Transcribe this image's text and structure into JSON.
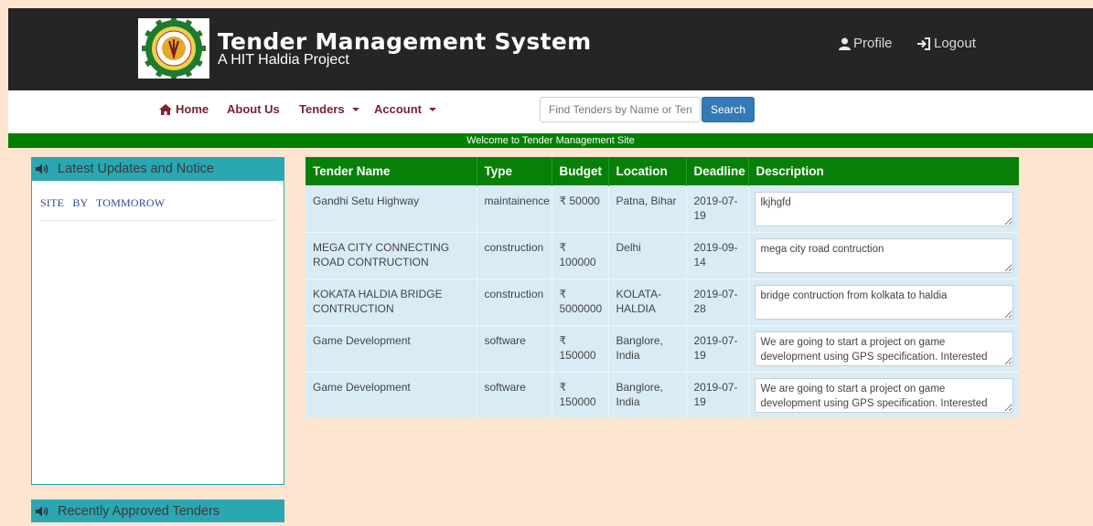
{
  "header": {
    "title": "Tender Management System",
    "subtitle": "A HIT Haldia Project",
    "logo_icon": "college-seal-logo",
    "profile_label": "Profile",
    "logout_label": "Logout"
  },
  "nav": {
    "home": "Home",
    "about": "About Us",
    "tenders": "Tenders",
    "account": "Account",
    "search_placeholder": "Find Tenders by Name or Tender Id",
    "search_button": "Search"
  },
  "welcome_text": "Welcome to Tender Management Site",
  "sidebar": {
    "updates_title": "Latest Updates and Notice",
    "notice": "SITE BY TOMMOROW",
    "approved_title": "Recently Approved Tenders"
  },
  "table": {
    "headers": [
      "Tender Name",
      "Type",
      "Budget",
      "Location",
      "Deadline",
      "Description"
    ],
    "rows": [
      {
        "name": "Gandhi Setu Highway",
        "type": "maintainence",
        "budget": "₹ 50000",
        "location": "Patna, Bihar",
        "deadline": "2019-07-19",
        "description": "lkjhgfd"
      },
      {
        "name": "MEGA CITY CONNECTING ROAD CONTRUCTION",
        "type": "construction",
        "budget": "₹ 100000",
        "location": "Delhi",
        "deadline": "2019-09-14",
        "description": "mega city road contruction"
      },
      {
        "name": "KOKATA HALDIA BRIDGE CONTRUCTION",
        "type": "construction",
        "budget": "₹ 5000000",
        "location": "KOLATA-HALDIA",
        "deadline": "2019-07-28",
        "description": "bridge contruction from kolkata to haldia"
      },
      {
        "name": "Game Development",
        "type": "software",
        "budget": "₹ 150000",
        "location": "Banglore, India",
        "deadline": "2019-07-19",
        "description": "We are going to start a project on game development using GPS specification. Interested"
      },
      {
        "name": "Game Development",
        "type": "software",
        "budget": "₹ 150000",
        "location": "Banglore, India",
        "deadline": "2019-07-19",
        "description": "We are going to start a project on game development using GPS specification. Interested"
      }
    ]
  },
  "colors": {
    "header_bg": "#252525",
    "page_bg": "#fde5cf",
    "nav_text": "#7b2233",
    "accent_green": "#088008",
    "panel_teal": "#2aa7b3",
    "row_bg": "#d9ecf5",
    "button_blue": "#337ab7"
  },
  "icons": [
    "college-seal-logo",
    "user-icon",
    "logout-icon",
    "home-icon",
    "speaker-icon"
  ]
}
